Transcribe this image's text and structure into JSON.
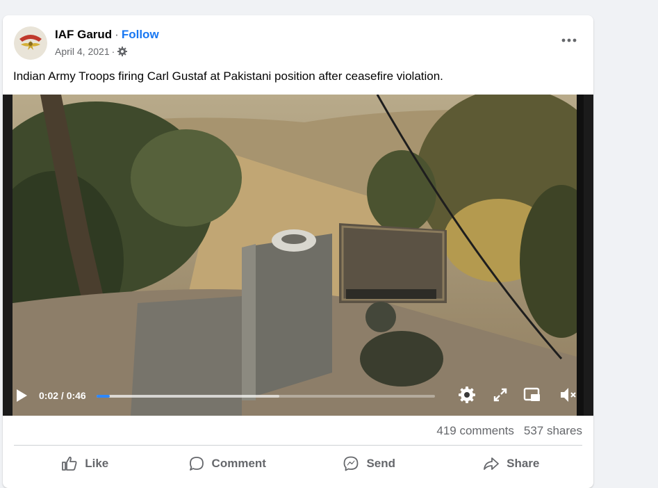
{
  "post": {
    "author": "IAF Garud",
    "separator": "·",
    "follow_label": "Follow",
    "date": "April 4, 2021",
    "privacy_icon": "gear-icon",
    "more_icon": "more-options-icon",
    "caption": "Indian Army Troops firing Carl Gustaf at Pakistani position after ceasefire violation."
  },
  "video": {
    "time_display": "0:02 / 0:46",
    "progress_played_fraction": 0.04,
    "progress_buffered_fraction": 0.54,
    "accent_color": "#2d88ff",
    "controls": [
      "play-icon",
      "settings-icon",
      "fullscreen-icon",
      "picture-in-picture-icon",
      "volume-muted-icon"
    ]
  },
  "stats": {
    "comments": "419 comments",
    "shares": "537 shares"
  },
  "actions": {
    "like": "Like",
    "comment": "Comment",
    "send": "Send",
    "share": "Share"
  },
  "colors": {
    "brand_blue": "#1877f2",
    "secondary_text": "#65676b",
    "page_background": "#f0f2f5"
  }
}
